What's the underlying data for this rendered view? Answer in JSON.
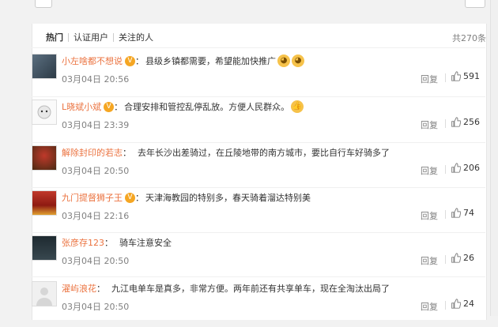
{
  "tabs": [
    "热门",
    "认证用户",
    "关注的人"
  ],
  "total": "共270条",
  "reply_label": "回复",
  "comments": [
    {
      "name": "小左啥都不想说",
      "badge": "V",
      "content": "县级乡镇都需要，希望能加快推广",
      "emojis": [
        "cat-face-icon",
        "cat-face-icon"
      ],
      "time": "03月04日 20:56",
      "likes": "591"
    },
    {
      "name": "L晓斌小斌",
      "badge": "V",
      "content": "合理安排和管控乱停乱放。方便人民群众。",
      "emojis": [
        "thumbs-up-icon"
      ],
      "time": "03月04日 23:39",
      "likes": "256"
    },
    {
      "name": "解除封印的若志",
      "badge": "",
      "content": "去年长沙出差骑过，在丘陵地带的南方城市，要比自行车好骑多了",
      "emojis": [],
      "time": "03月04日 20:50",
      "likes": "206"
    },
    {
      "name": "九门提督狮子王",
      "badge": "V",
      "content": "天津海教园的特别多，春天骑着溜达特别美",
      "emojis": [],
      "time": "03月04日 22:16",
      "likes": "74"
    },
    {
      "name": "张彦存123",
      "badge": "",
      "content": "骑车注意安全",
      "emojis": [],
      "time": "03月04日 20:50",
      "likes": "26"
    },
    {
      "name": "濯屿浪花",
      "badge": "",
      "content": "九江电单车是真多，非常方便。两年前还有共享单车，现在全淘汰出局了",
      "emojis": [],
      "time": "03月04日 20:50",
      "likes": "24"
    }
  ],
  "colors": {
    "username": "#eb7340",
    "badge": "#f5a623",
    "meta": "#808080"
  }
}
